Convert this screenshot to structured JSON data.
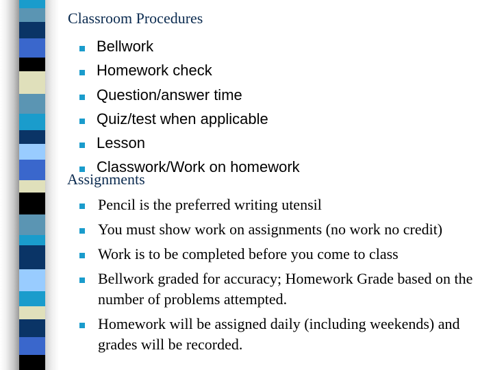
{
  "slide": {
    "title": "Classroom Procedures",
    "procedures": [
      "Bellwork",
      "Homework check",
      "Question/answer time",
      "Quiz/test when applicable",
      "Lesson",
      "Classwork/Work on homework"
    ],
    "assignments_heading": "Assignments",
    "assignments": [
      "Pencil is the preferred writing utensil",
      "You must show work on assignments (no work no credit)",
      "Work is to be completed before you come to class",
      "Bellwork graded for accuracy; Homework Grade based on the number of problems attempted.",
      "Homework will be assigned daily (including weekends) and grades will be recorded."
    ]
  },
  "theme": {
    "bullet_color": "#1a9ccc",
    "title_color": "#0a2a4f",
    "stripe_colors": [
      "#1a9ccc",
      "#5b95b3",
      "#0a3466",
      "#3a67cc",
      "#000000",
      "#e0e0bb",
      "#5b95b3",
      "#1a9ccc",
      "#0a3466",
      "#99ccff",
      "#3a67cc",
      "#e0e0bb",
      "#000000",
      "#5b95b3",
      "#1a9ccc",
      "#0a3466",
      "#99ccff",
      "#1a9ccc",
      "#e0e0bb",
      "#0a3466",
      "#3a67cc",
      "#000000"
    ]
  }
}
